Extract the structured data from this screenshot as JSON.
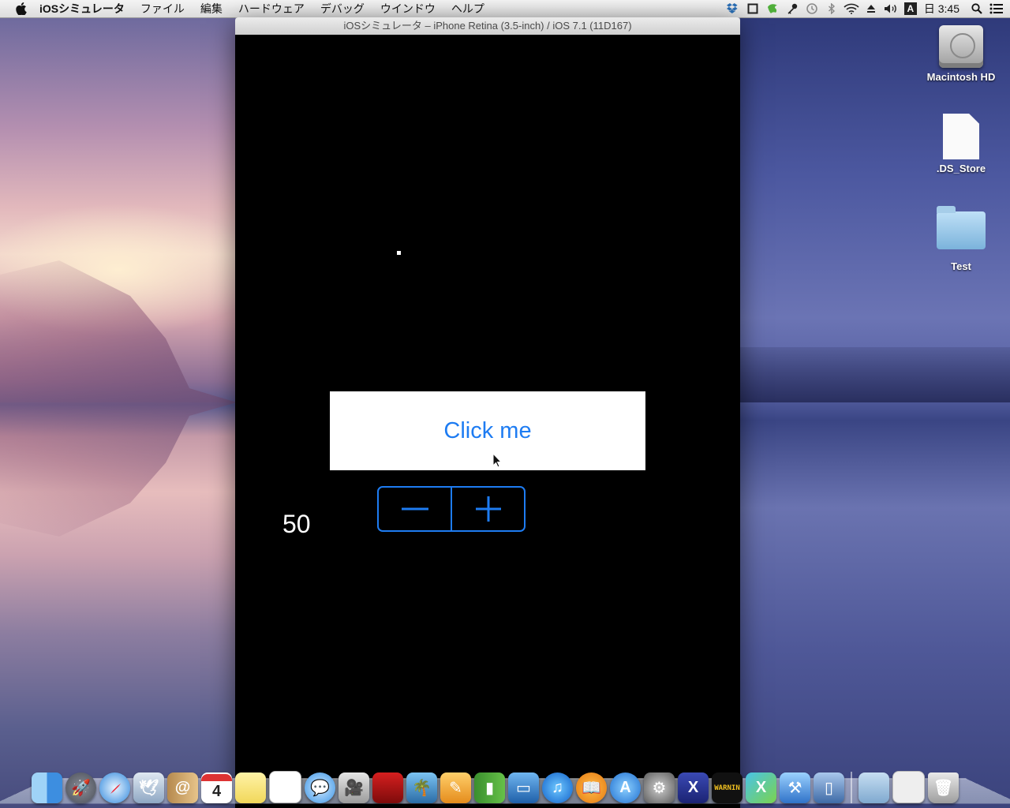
{
  "menubar": {
    "app_name": "iOSシミュレータ",
    "items": [
      "ファイル",
      "編集",
      "ハードウェア",
      "デバッグ",
      "ウインドウ",
      "ヘルプ"
    ],
    "clock": "日 3:45",
    "input_indicator": "A"
  },
  "simulator": {
    "window_title": "iOSシミュレータ – iPhone Retina (3.5-inch) / iOS 7.1 (11D167)",
    "button_label": "Click me",
    "counter_value": "50",
    "accent_color": "#1e7cf2"
  },
  "desktop_icons": [
    {
      "label": "Macintosh HD",
      "icon": "hard-drive-icon"
    },
    {
      "label": ".DS_Store",
      "icon": "document-icon"
    },
    {
      "label": "Test",
      "icon": "folder-icon"
    }
  ],
  "dock": {
    "apps": [
      "finder-icon",
      "launchpad-icon",
      "safari-icon",
      "mail-icon",
      "contacts-icon",
      "calendar-icon",
      "notes-icon",
      "reminders-icon",
      "messages-icon",
      "facetime-icon",
      "photo-booth-icon",
      "iphoto-icon",
      "pages-icon",
      "numbers-icon",
      "keynote-icon",
      "itunes-icon",
      "ibooks-icon",
      "app-store-icon",
      "system-preferences-icon",
      "xamarin-icon",
      "console-icon",
      "xamarin-studio-icon",
      "xcode-icon",
      "ios-simulator-icon"
    ],
    "calendar_day": "4",
    "console_text": "WARNIN",
    "others": [
      "downloads-folder-icon",
      "documents-stack-icon",
      "trash-icon"
    ]
  }
}
